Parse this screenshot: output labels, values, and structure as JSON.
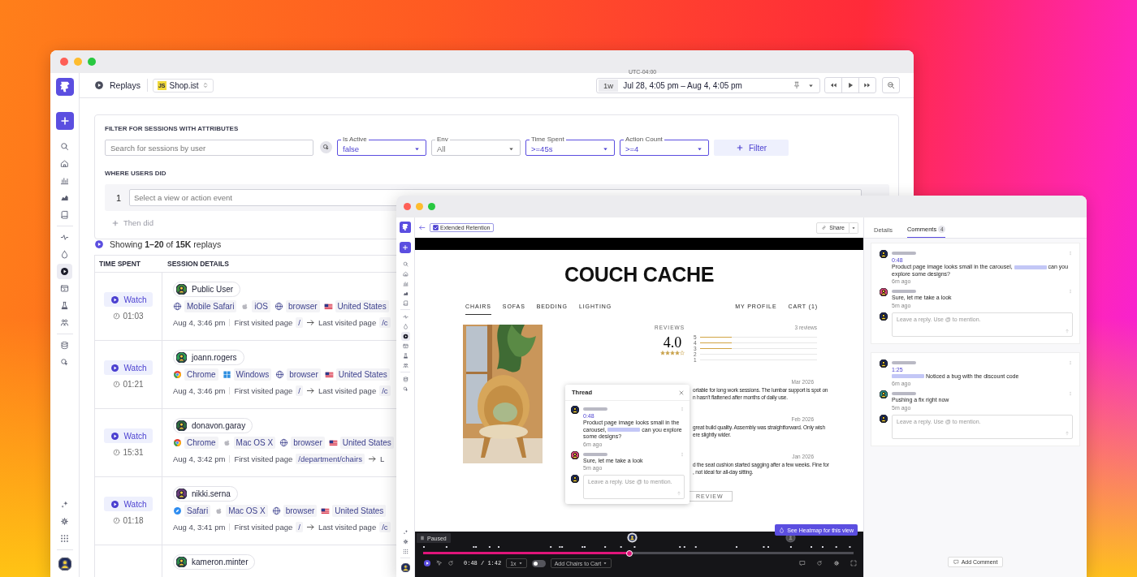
{
  "main_window": {
    "sidebar": {
      "items": [
        {
          "selected": false
        },
        {
          "selected": false
        },
        {
          "selected": false
        },
        {
          "selected": false
        },
        {
          "selected": false
        },
        {
          "selected": false
        },
        {
          "selected": false
        },
        {
          "selected": true
        },
        {
          "selected": false
        },
        {
          "selected": false
        },
        {
          "selected": false
        },
        {
          "selected": false
        },
        {
          "selected": false
        }
      ]
    },
    "header": {
      "title": "Replays",
      "app_badge": "JS",
      "app": "Shop.ist"
    },
    "time_range": {
      "timezone": "UTC-04:00",
      "preset": "1w",
      "range": "Jul 28, 4:05 pm – Aug 4, 4:05 pm"
    },
    "filters": {
      "heading": "FILTER FOR SESSIONS WITH ATTRIBUTES",
      "search_placeholder": "Search for sessions by user",
      "selects": [
        {
          "label": "Is Active",
          "value": "false",
          "active": true
        },
        {
          "label": "Env",
          "value": "All",
          "active": false
        },
        {
          "label": "Time Spent",
          "value": ">=45s",
          "active": true
        },
        {
          "label": "Action Count",
          "value": ">=4",
          "active": true
        }
      ],
      "filter_button": "Filter"
    },
    "where": {
      "heading": "WHERE USERS DID",
      "steps": [
        {
          "number": "1",
          "placeholder": "Select a view or action event"
        }
      ],
      "add": "Then did"
    },
    "summary": "Showing **1–20** of **15K** replays",
    "table": {
      "columns": [
        "TIME SPENT",
        "SESSION DETAILS"
      ],
      "rows": [
        {
          "watch": "Watch",
          "duration": "01:03",
          "user": "Public User",
          "color": "#3d8b3d",
          "tags": [
            {
              "kind": "globe",
              "label": "Mobile Safari"
            },
            {
              "kind": "apple",
              "label": "iOS"
            },
            {
              "kind": "globe",
              "label": "browser"
            },
            {
              "kind": "flag",
              "label": "United States"
            }
          ],
          "date": "Aug 4, 3:46 pm",
          "first_label": "First visited page",
          "first_page": "/",
          "last_label": "Last visited page",
          "last_page": "/c"
        },
        {
          "watch": "Watch",
          "duration": "01:21",
          "user": "joann.rogers",
          "color": "#2f9e55",
          "tags": [
            {
              "kind": "chrome",
              "label": "Chrome"
            },
            {
              "kind": "windows",
              "label": "Windows"
            },
            {
              "kind": "globe",
              "label": "browser"
            },
            {
              "kind": "flag",
              "label": "United States"
            }
          ],
          "date": "Aug 4, 3:46 pm",
          "first_label": "First visited page",
          "first_page": "/",
          "last_label": "Last visited page",
          "last_page": "/c"
        },
        {
          "watch": "Watch",
          "duration": "15:31",
          "user": "donavon.garay",
          "color": "#2e6b3c",
          "tags": [
            {
              "kind": "chrome",
              "label": "Chrome"
            },
            {
              "kind": "apple",
              "label": "Mac OS X"
            },
            {
              "kind": "globe",
              "label": "browser"
            },
            {
              "kind": "flag",
              "label": "United States"
            }
          ],
          "date": "Aug 4, 3:42 pm",
          "first_label": "First visited page",
          "first_page": "/department/chairs",
          "next_label": "L"
        },
        {
          "watch": "Watch",
          "duration": "01:18",
          "user": "nikki.serna",
          "color": "#6b3d7a",
          "tags": [
            {
              "kind": "safari",
              "label": "Safari"
            },
            {
              "kind": "apple",
              "label": "Mac OS X"
            },
            {
              "kind": "globe",
              "label": "browser"
            },
            {
              "kind": "flag",
              "label": "United States"
            }
          ],
          "date": "Aug 4, 3:41 pm",
          "first_label": "First visited page",
          "first_page": "/",
          "last_label": "Last visited page",
          "last_page": "/c"
        },
        {
          "user": "kameron.minter",
          "color": "#2f8a4a"
        }
      ]
    }
  },
  "replay_window": {
    "sidebar": {
      "items": [
        {
          "selected": false
        },
        {
          "selected": false
        },
        {
          "selected": false
        },
        {
          "selected": false
        },
        {
          "selected": false
        },
        {
          "selected": false
        },
        {
          "selected": false
        },
        {
          "selected": true
        },
        {
          "selected": false
        },
        {
          "selected": false
        },
        {
          "selected": false
        },
        {
          "selected": false
        },
        {
          "selected": false
        }
      ]
    },
    "retention": {
      "label": "Extended Retention",
      "checked": true
    },
    "share": "Share",
    "page": {
      "brand": "COUCH CACHE",
      "nav": [
        {
          "label": "CHAIRS",
          "selected": true
        },
        {
          "label": "SOFAS",
          "selected": false
        },
        {
          "label": "BEDDING",
          "selected": false
        },
        {
          "label": "LIGHTING",
          "selected": false
        }
      ],
      "account_nav": [
        "MY PROFILE",
        "CART (1)"
      ],
      "reviews": {
        "heading": "REVIEWS",
        "count": "3 reviews",
        "score": "4.0",
        "stars": 4,
        "bars": [
          {
            "label": "5",
            "level": 0.27
          },
          {
            "label": "4",
            "level": 0.27
          },
          {
            "label": "3",
            "level": 0.27
          },
          {
            "label": "2"
          },
          {
            "label": "1"
          }
        ],
        "entries": [
          {
            "date": "Mar 2026",
            "lines": [
              "ortable for long work sessions. The lumbar support is spot on",
              "n hasn't flattened after months of daily use."
            ]
          },
          {
            "date": "Feb 2026",
            "lines": [
              "great build quality. Assembly was straightforward. Only wish",
              "ere slightly wider."
            ]
          },
          {
            "date": "Jan 2026",
            "lines": [
              "d the seat cushion started sagging after a few weeks. Fine for",
              ", not ideal for all-day sitting."
            ]
          }
        ],
        "button": "REVIEW"
      }
    },
    "thread": {
      "title": "Thread",
      "comments": [
        {
          "color": "#1d2a5c",
          "time": "0:48",
          "text_before": "Product page image looks small in the carousel,",
          "mention": true,
          "text": "can you explore some designs?",
          "age": "6m ago"
        },
        {
          "color": "#d9467a",
          "text": "Sure, let me take a look",
          "age": "5m ago"
        }
      ],
      "reply_placeholder": "Leave a reply. Use @ to mention."
    },
    "heatmap_button": "See Heatmap for this view",
    "player": {
      "status": "Paused",
      "level": 0.48,
      "time": "0:48 / 1:42",
      "speed": "1x",
      "skip_inactivity": false,
      "action": "Add Chairs to Cart"
    },
    "panel": {
      "tabs": [
        {
          "label": "Details",
          "selected": false
        },
        {
          "label": "Comments",
          "selected": true,
          "count": "4"
        }
      ],
      "threads": [
        {
          "comments": [
            {
              "color": "#1d2a5c",
              "time": "0:48",
              "text_before": "Product page image looks small in the carousel,",
              "mention": true,
              "text": "can you explore some designs?",
              "age": "6m ago"
            },
            {
              "color": "#d9467a",
              "text": "Sure, let me take a look",
              "age": "5m ago"
            }
          ],
          "reply_placeholder": "Leave a reply. Use @ to mention."
        },
        {
          "comments": [
            {
              "color": "#1d2a5c",
              "time": "1:25",
              "mention": true,
              "text": "Noticed a bug with the discount code",
              "age": "6m ago"
            },
            {
              "color": "#2f8f8a",
              "text": "Pushing a fix right now",
              "age": "5m ago"
            }
          ],
          "reply_placeholder": "Leave a reply. Use @ to mention."
        }
      ],
      "add_comment": "Add Comment"
    }
  }
}
